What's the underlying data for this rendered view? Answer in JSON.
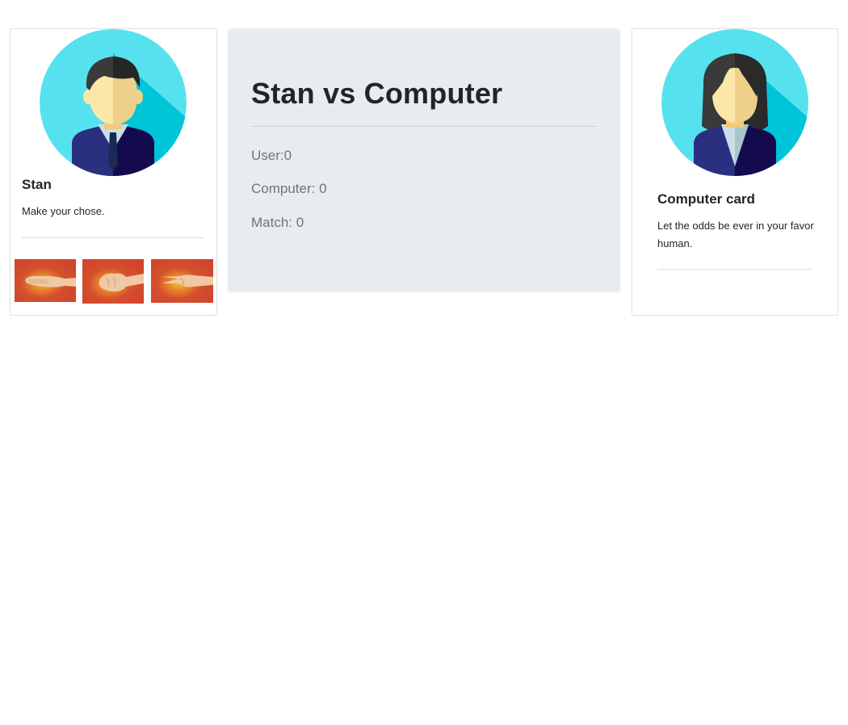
{
  "player": {
    "name": "Stan",
    "prompt": "Make your chose.",
    "choices": [
      {
        "id": "paper",
        "icon": "paper-hand-icon"
      },
      {
        "id": "rock",
        "icon": "rock-fist-icon"
      },
      {
        "id": "scissors",
        "icon": "scissors-hand-icon"
      }
    ],
    "avatar_icon": "male-businessman-avatar-icon"
  },
  "scoreboard": {
    "title": "Stan vs Computer",
    "user_score": "User:0",
    "computer_score": "Computer: 0",
    "match_score": "Match: 0"
  },
  "computer": {
    "title": "Computer card",
    "text": "Let the odds be ever in your favor human.",
    "avatar_icon": "female-businesswoman-avatar-icon"
  },
  "colors": {
    "avatar_bg": "#55e2ee",
    "avatar_shadow": "#00c4d8",
    "suit_navy": "#2a2d7a",
    "scoreboard_bg": "#e9ecef",
    "choice_bg": "#cf3f2c"
  }
}
